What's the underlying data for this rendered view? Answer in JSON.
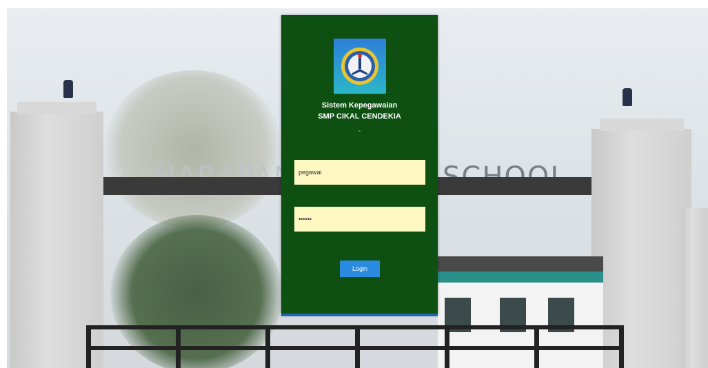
{
  "background": {
    "sign_text": "SCHOOL"
  },
  "login_panel": {
    "title_line1": "Sistem Kepegawaian",
    "title_line2": "SMP CIKAL CENDEKIA",
    "separator": "-",
    "username": {
      "value": "pegawai",
      "placeholder": ""
    },
    "password": {
      "value": "••••••",
      "placeholder": ""
    },
    "login_label": "Login",
    "colors": {
      "panel": "#0e5012",
      "input": "#fdf8c2",
      "button": "#2a8be0",
      "logo": "#2bb6c9"
    },
    "logo_icon": "school-emblem-icon"
  }
}
